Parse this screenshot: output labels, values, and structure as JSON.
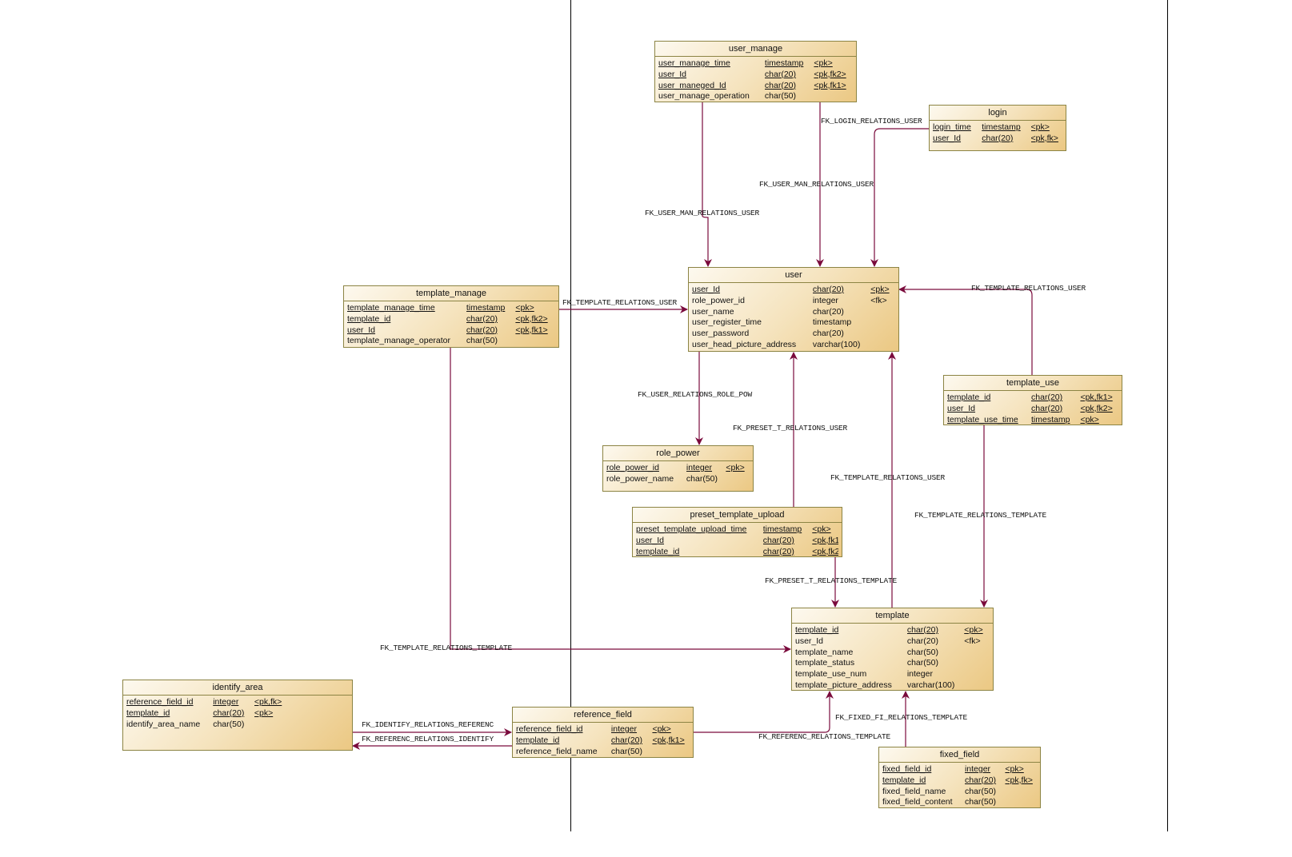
{
  "colors": {
    "link": "#7a0a3c",
    "table_border": "#8c8444",
    "table_fill_light": "#fdf9ef",
    "table_fill_dark": "#ebc883",
    "divider": "#000000"
  },
  "tables": [
    {
      "name": "user_manage",
      "columns": [
        {
          "name": "user_manage_time",
          "type": "timestamp",
          "key": "<pk>",
          "pk": true
        },
        {
          "name": "user_Id",
          "type": "char(20)",
          "key": "<pk,fk2>",
          "pk": true
        },
        {
          "name": "user_maneged_Id",
          "type": "char(20)",
          "key": "<pk,fk1>",
          "pk": true
        },
        {
          "name": "user_manage_operation",
          "type": "char(50)",
          "key": "",
          "pk": false
        }
      ]
    },
    {
      "name": "login",
      "columns": [
        {
          "name": "login_time",
          "type": "timestamp",
          "key": "<pk>",
          "pk": true
        },
        {
          "name": "user_Id",
          "type": "char(20)",
          "key": "<pk,fk>",
          "pk": true
        }
      ]
    },
    {
      "name": "template_manage",
      "columns": [
        {
          "name": "template_manage_time",
          "type": "timestamp",
          "key": "<pk>",
          "pk": true
        },
        {
          "name": "template_id",
          "type": "char(20)",
          "key": "<pk,fk2>",
          "pk": true
        },
        {
          "name": "user_Id",
          "type": "char(20)",
          "key": "<pk,fk1>",
          "pk": true
        },
        {
          "name": "template_manage_operator",
          "type": "char(50)",
          "key": "",
          "pk": false
        }
      ]
    },
    {
      "name": "user",
      "columns": [
        {
          "name": "user_Id",
          "type": "char(20)",
          "key": "<pk>",
          "pk": true
        },
        {
          "name": "role_power_id",
          "type": "integer",
          "key": "<fk>",
          "pk": false
        },
        {
          "name": "user_name",
          "type": "char(20)",
          "key": "",
          "pk": false
        },
        {
          "name": "user_register_time",
          "type": "timestamp",
          "key": "",
          "pk": false
        },
        {
          "name": "user_password",
          "type": "char(20)",
          "key": "",
          "pk": false
        },
        {
          "name": "user_head_picture_address",
          "type": "varchar(100)",
          "key": "",
          "pk": false
        }
      ]
    },
    {
      "name": "template_use",
      "columns": [
        {
          "name": "template_id",
          "type": "char(20)",
          "key": "<pk,fk1>",
          "pk": true
        },
        {
          "name": "user_Id",
          "type": "char(20)",
          "key": "<pk,fk2>",
          "pk": true
        },
        {
          "name": "template_use_time",
          "type": "timestamp",
          "key": "<pk>",
          "pk": true
        }
      ]
    },
    {
      "name": "role_power",
      "columns": [
        {
          "name": "role_power_id",
          "type": "integer",
          "key": "<pk>",
          "pk": true
        },
        {
          "name": "role_power_name",
          "type": "char(50)",
          "key": "",
          "pk": false
        }
      ]
    },
    {
      "name": "preset_template_upload",
      "columns": [
        {
          "name": "preset_template_upload_time",
          "type": "timestamp",
          "key": "<pk>",
          "pk": true
        },
        {
          "name": "user_Id",
          "type": "char(20)",
          "key": "<pk,fk1>",
          "pk": true
        },
        {
          "name": "template_id",
          "type": "char(20)",
          "key": "<pk,fk2>",
          "pk": true
        }
      ]
    },
    {
      "name": "template",
      "columns": [
        {
          "name": "template_id",
          "type": "char(20)",
          "key": "<pk>",
          "pk": true
        },
        {
          "name": "user_Id",
          "type": "char(20)",
          "key": "<fk>",
          "pk": false
        },
        {
          "name": "template_name",
          "type": "char(50)",
          "key": "",
          "pk": false
        },
        {
          "name": "template_status",
          "type": "char(50)",
          "key": "",
          "pk": false
        },
        {
          "name": "template_use_num",
          "type": "integer",
          "key": "",
          "pk": false
        },
        {
          "name": "template_picture_address",
          "type": "varchar(100)",
          "key": "",
          "pk": false
        }
      ]
    },
    {
      "name": "identify_area",
      "columns": [
        {
          "name": "reference_field_id",
          "type": "integer",
          "key": "<pk,fk>",
          "pk": true
        },
        {
          "name": "template_id",
          "type": "char(20)",
          "key": "<pk>",
          "pk": true
        },
        {
          "name": "identify_area_name",
          "type": "char(50)",
          "key": "",
          "pk": false
        }
      ]
    },
    {
      "name": "reference_field",
      "columns": [
        {
          "name": "reference_field_id",
          "type": "integer",
          "key": "<pk>",
          "pk": true
        },
        {
          "name": "template_id",
          "type": "char(20)",
          "key": "<pk,fk1>",
          "pk": true
        },
        {
          "name": "reference_field_name",
          "type": "char(50)",
          "key": "",
          "pk": false
        }
      ]
    },
    {
      "name": "fixed_field",
      "columns": [
        {
          "name": "fixed_field_id",
          "type": "integer",
          "key": "<pk>",
          "pk": true
        },
        {
          "name": "template_id",
          "type": "char(20)",
          "key": "<pk,fk>",
          "pk": true
        },
        {
          "name": "fixed_field_name",
          "type": "char(50)",
          "key": "",
          "pk": false
        },
        {
          "name": "fixed_field_content",
          "type": "char(50)",
          "key": "",
          "pk": false
        }
      ]
    }
  ],
  "relationships": [
    {
      "label": "FK_USER_MAN_RELATIONS_USER",
      "from": "user_manage",
      "to": "user"
    },
    {
      "label": "FK_USER_MAN_RELATIONS_USER",
      "from": "user_manage",
      "to": "user"
    },
    {
      "label": "FK_LOGIN_RELATIONS_USER",
      "from": "login",
      "to": "user"
    },
    {
      "label": "FK_TEMPLATE_RELATIONS_USER",
      "from": "template_manage",
      "to": "user"
    },
    {
      "label": "FK_USER_RELATIONS_ROLE_POW",
      "from": "user",
      "to": "role_power"
    },
    {
      "label": "FK_PRESET_T_RELATIONS_USER",
      "from": "preset_template_upload",
      "to": "user"
    },
    {
      "label": "FK_TEMPLATE_RELATIONS_USER",
      "from": "template",
      "to": "user"
    },
    {
      "label": "FK_TEMPLATE_RELATIONS_USER",
      "from": "template_use",
      "to": "user"
    },
    {
      "label": "FK_TEMPLATE_RELATIONS_TEMPLATE",
      "from": "template_use",
      "to": "template"
    },
    {
      "label": "FK_PRESET_T_RELATIONS_TEMPLATE",
      "from": "preset_template_upload",
      "to": "template"
    },
    {
      "label": "FK_TEMPLATE_RELATIONS_TEMPLATE",
      "from": "template_manage",
      "to": "template"
    },
    {
      "label": "FK_IDENTIFY_RELATIONS_REFERENC",
      "from": "identify_area",
      "to": "reference_field"
    },
    {
      "label": "FK_REFERENC_RELATIONS_IDENTIFY",
      "from": "reference_field",
      "to": "identify_area"
    },
    {
      "label": "FK_REFERENC_RELATIONS_TEMPLATE",
      "from": "reference_field",
      "to": "template"
    },
    {
      "label": "FK_FIXED_FI_RELATIONS_TEMPLATE",
      "from": "fixed_field",
      "to": "template"
    }
  ]
}
